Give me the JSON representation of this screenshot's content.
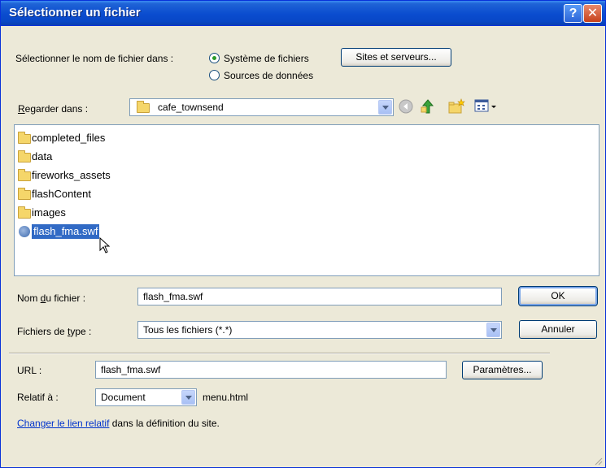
{
  "title": "Sélectionner un fichier",
  "titlebar": {
    "help_glyph": "?",
    "close_glyph": "✕"
  },
  "select_source": {
    "label": "Sélectionner le nom de fichier dans :",
    "options": [
      "Système de fichiers",
      "Sources de données"
    ],
    "selected": "Système de fichiers"
  },
  "sites_button": "Sites et serveurs...",
  "look_in": {
    "label_prefix": "",
    "label_u": "R",
    "label_rest": "egarder dans :",
    "value": "cafe_townsend"
  },
  "files": [
    {
      "name": "completed_files",
      "type": "folder"
    },
    {
      "name": "data",
      "type": "folder"
    },
    {
      "name": "fireworks_assets",
      "type": "folder"
    },
    {
      "name": "flashContent",
      "type": "folder"
    },
    {
      "name": "images",
      "type": "folder"
    },
    {
      "name": "flash_fma.swf",
      "type": "swf",
      "selected": true
    }
  ],
  "filename": {
    "label_prefix": "Nom ",
    "label_u": "d",
    "label_rest": "u fichier :",
    "value": "flash_fma.swf"
  },
  "filetype": {
    "label_prefix": "Fichiers de ",
    "label_u": "t",
    "label_rest": "ype :",
    "value": "Tous les fichiers (*.*)"
  },
  "ok_button": "OK",
  "cancel_button": "Annuler",
  "url": {
    "label": "URL :",
    "value": "flash_fma.swf"
  },
  "params_button": "Paramètres...",
  "relative": {
    "label": "Relatif à :",
    "value": "Document",
    "file": "menu.html"
  },
  "change_link": {
    "link_text": "Changer le lien relatif",
    "rest": " dans la définition  du site."
  },
  "colors": {
    "title_bar": "#0a4ccf",
    "selection": "#316ac5",
    "link": "#0033cc",
    "dialog_bg": "#ece9d8"
  }
}
